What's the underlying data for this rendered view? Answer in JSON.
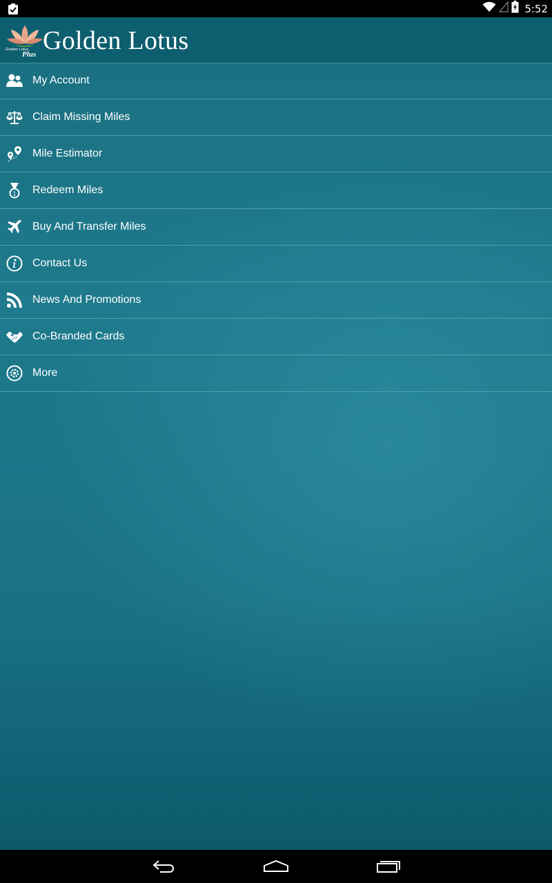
{
  "status_bar": {
    "time": "5:52",
    "left_icon": "clipboard-check-icon",
    "icons": [
      "wifi-icon",
      "signal-icon",
      "battery-icon"
    ]
  },
  "header": {
    "brand_title": "Golden Lotus",
    "logo_text": "Golden Lotus",
    "logo_plus": "Plus",
    "logo_icon": "lotus-flower-icon"
  },
  "menu": {
    "items": [
      {
        "label": "My Account",
        "icon": "users-icon"
      },
      {
        "label": "Claim Missing Miles",
        "icon": "scales-icon"
      },
      {
        "label": "Mile Estimator",
        "icon": "map-pins-icon"
      },
      {
        "label": "Redeem Miles",
        "icon": "medal-icon"
      },
      {
        "label": "Buy And Transfer Miles",
        "icon": "airplane-icon"
      },
      {
        "label": "Contact Us",
        "icon": "info-icon"
      },
      {
        "label": "News And Promotions",
        "icon": "rss-icon"
      },
      {
        "label": "Co-Branded Cards",
        "icon": "handshake-icon"
      },
      {
        "label": "More",
        "icon": "gear-icon"
      }
    ]
  },
  "nav_bar": {
    "buttons": [
      "back-icon",
      "home-icon",
      "recent-apps-icon"
    ]
  },
  "colors": {
    "header_bg": "#0d5e6e",
    "app_bg": "#1e7a8c",
    "divider": "#4b9fae",
    "text": "#ffffff"
  }
}
